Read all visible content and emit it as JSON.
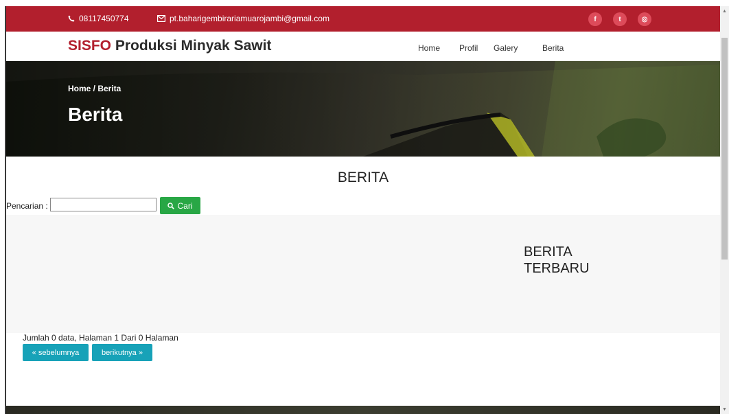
{
  "topbar": {
    "phone": "08117450774",
    "email": "pt.baharigembirariamuarojambi@gmail.com",
    "social": [
      {
        "icon": "facebook-icon",
        "glyph": "f"
      },
      {
        "icon": "twitter-icon",
        "glyph": "t"
      },
      {
        "icon": "instagram-icon",
        "glyph": "◎"
      }
    ],
    "bg_color": "#b21f2d"
  },
  "navbar": {
    "brand_accent": "SISFO",
    "brand_rest": " Produksi Minyak Sawit",
    "links": [
      "Home",
      "Profil",
      "Galery",
      "Berita"
    ]
  },
  "hero": {
    "breadcrumb": "Home  /  Berita",
    "title": "Berita"
  },
  "main": {
    "section_title": "BERITA",
    "search": {
      "label": "Pencarian :",
      "value": "",
      "button_label": "Cari"
    },
    "latest_title": "BERITA TERBARU",
    "pagination": {
      "summary": "Jumlah 0 data, Halaman 1 Dari 0 Halaman",
      "prev_label": "« sebelumnya",
      "next_label": "berikutnya »"
    }
  },
  "colors": {
    "search_button": "#28a745",
    "pagination_button": "#17a2b8"
  }
}
